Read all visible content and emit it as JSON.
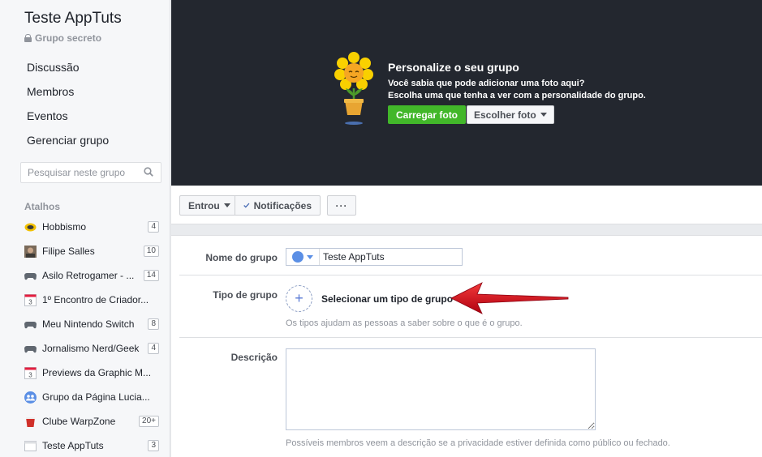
{
  "sidebar": {
    "group_name": "Teste AppTuts",
    "privacy": "Grupo secreto",
    "nav": [
      "Discussão",
      "Membros",
      "Eventos",
      "Gerenciar grupo"
    ],
    "search_placeholder": "Pesquisar neste grupo",
    "shortcuts_title": "Atalhos",
    "shortcuts": [
      {
        "label": "Hobbismo",
        "badge": "4",
        "icon": "hobbismo-icon"
      },
      {
        "label": "Filipe Salles",
        "badge": "10",
        "icon": "profile-photo-icon"
      },
      {
        "label": "Asilo Retrogamer - ...",
        "badge": "14",
        "icon": "gamepad-icon"
      },
      {
        "label": "1º Encontro de Criador...",
        "badge": "",
        "icon": "calendar-icon"
      },
      {
        "label": "Meu Nintendo Switch",
        "badge": "8",
        "icon": "gamepad-icon"
      },
      {
        "label": "Jornalismo Nerd/Geek",
        "badge": "4",
        "icon": "gamepad-icon"
      },
      {
        "label": "Previews da Graphic M...",
        "badge": "",
        "icon": "calendar-icon"
      },
      {
        "label": "Grupo da Página Lucia...",
        "badge": "",
        "icon": "group-icon"
      },
      {
        "label": "Clube WarpZone",
        "badge": "20+",
        "icon": "cup-icon"
      },
      {
        "label": "Teste AppTuts",
        "badge": "3",
        "icon": "group-window-icon"
      }
    ]
  },
  "cover": {
    "title": "Personalize o seu grupo",
    "line1": "Você sabia que pode adicionar uma foto aqui?",
    "line2": "Escolha uma que tenha a ver com a personalidade do grupo.",
    "upload_label": "Carregar foto",
    "choose_label": "Escolher foto"
  },
  "actions": {
    "joined_label": "Entrou",
    "notifications_label": "Notificações",
    "more_label": "···"
  },
  "form": {
    "name_label": "Nome do grupo",
    "name_value": "Teste AppTuts",
    "type_label": "Tipo de grupo",
    "type_select_label": "Selecionar um tipo de grupo",
    "type_helper": "Os tipos ajudam as pessoas a saber sobre o que é o grupo.",
    "description_label": "Descrição",
    "description_value": "",
    "description_helper": "Possíveis membros veem a descrição se a privacidade estiver definida como público ou fechado."
  },
  "colors": {
    "accent_green": "#42b72a",
    "cover_bg": "#23272f",
    "arrow_red": "#d0021b",
    "link_blue": "#4267b2"
  }
}
